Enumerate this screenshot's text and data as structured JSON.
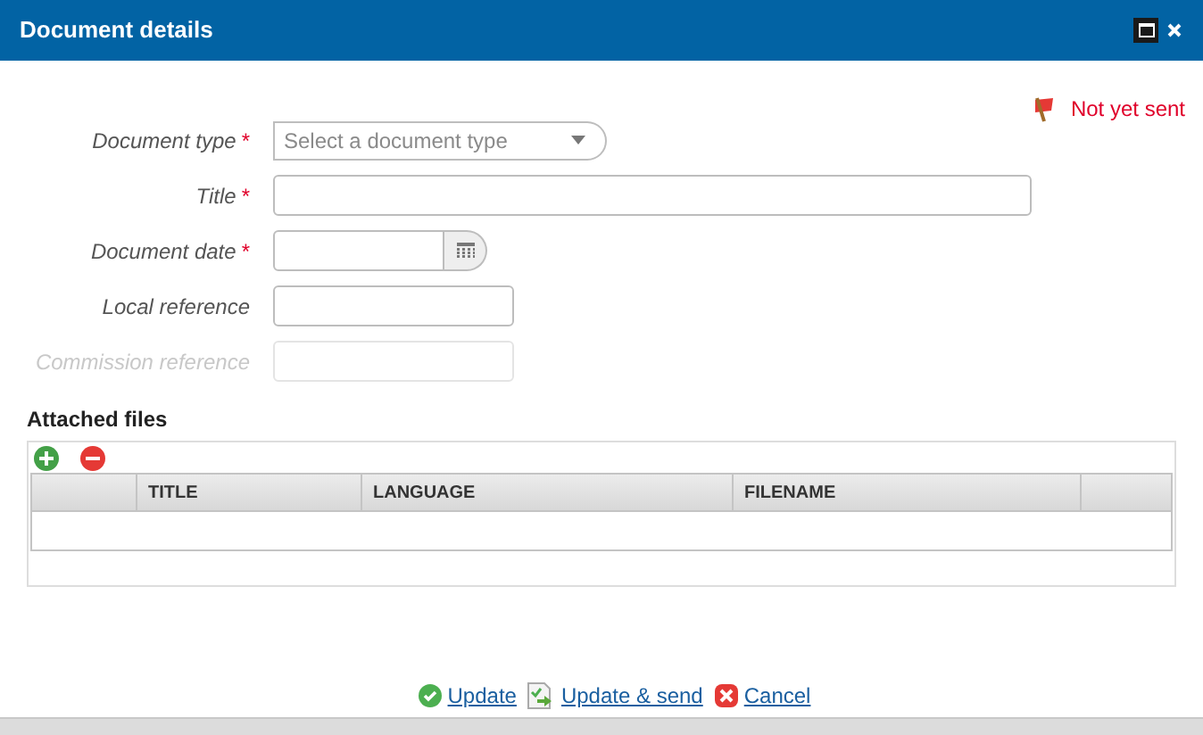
{
  "window": {
    "title": "Document details"
  },
  "status": {
    "text": "Not yet sent"
  },
  "required_marker": "*",
  "fields": [
    {
      "label": "Document type",
      "required": true,
      "disabled": false,
      "kind": "select",
      "placeholder": "Select a document type"
    },
    {
      "label": "Title",
      "required": true,
      "disabled": false,
      "kind": "wide"
    },
    {
      "label": "Document date",
      "required": true,
      "disabled": false,
      "kind": "date"
    },
    {
      "label": "Local reference",
      "required": false,
      "disabled": false,
      "kind": "short"
    },
    {
      "label": "Commission reference",
      "required": false,
      "disabled": true,
      "kind": "short"
    }
  ],
  "attached_files": {
    "heading": "Attached files",
    "columns": [
      "",
      "TITLE",
      "LANGUAGE",
      "FILENAME",
      ""
    ]
  },
  "actions": [
    {
      "label": "Update",
      "kind": "ok"
    },
    {
      "label": "Update & send",
      "kind": "send"
    },
    {
      "label": "Cancel",
      "kind": "cancel"
    }
  ]
}
